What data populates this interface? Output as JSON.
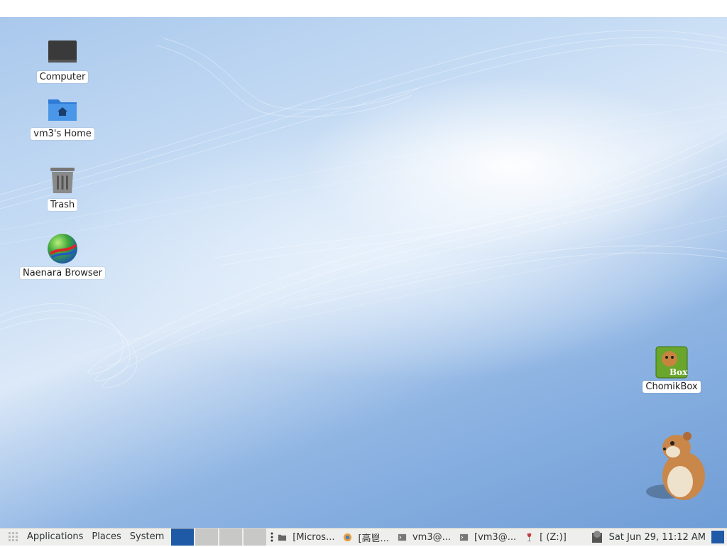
{
  "desktop": {
    "icons": [
      {
        "label": "Computer",
        "icon": "computer-icon"
      },
      {
        "label": "vm3's Home",
        "icon": "home-folder-icon"
      },
      {
        "label": "Trash",
        "icon": "trash-icon"
      },
      {
        "label": "Naenara Browser",
        "icon": "browser-globe-icon"
      },
      {
        "label": "ChomikBox",
        "icon": "chomikbox-icon",
        "badge": "Box"
      }
    ]
  },
  "panel": {
    "menus": [
      "Applications",
      "Places",
      "System"
    ],
    "workspaces": 4,
    "active_workspace": 1,
    "tasks": [
      {
        "label": "[Micros...",
        "icon": "folder-icon"
      },
      {
        "label": "[⾼⾿...",
        "icon": "browser-icon"
      },
      {
        "label": "vm3@...",
        "icon": "terminal-icon"
      },
      {
        "label": "[vm3@...",
        "icon": "terminal-icon"
      },
      {
        "label": "[ (Z:)]",
        "icon": "wine-glass-icon"
      }
    ],
    "clock": "Sat Jun 29, 11:12 AM"
  },
  "colors": {
    "accent": "#1f5aa6",
    "panel": "#eeeeec"
  }
}
